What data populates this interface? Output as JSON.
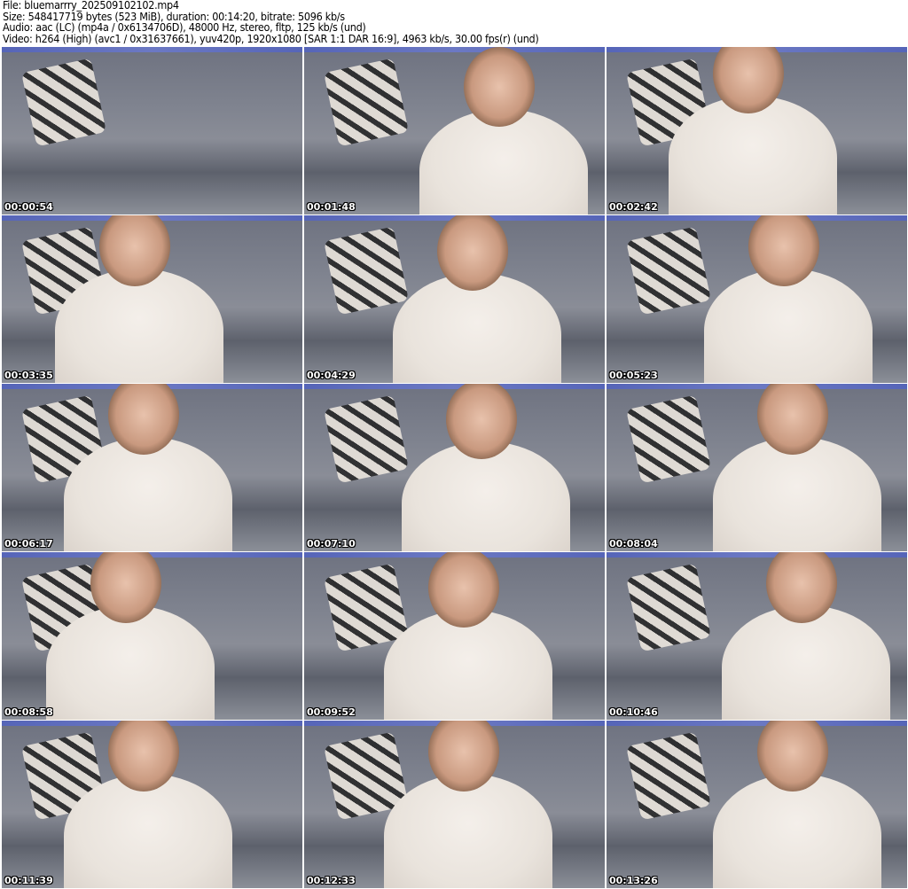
{
  "header": {
    "file": "File: bluemarrry_202509102102.mp4",
    "size": "Size: 548417719 bytes (523 MiB), duration: 00:14:20, bitrate: 5096 kb/s",
    "audio": "Audio: aac (LC) (mp4a / 0x6134706D), 48000 Hz, stereo, fltp, 125 kb/s (und)",
    "video": "Video: h264 (High) (avc1 / 0x31637661), yuv420p, 1920x1080 [SAR 1:1 DAR 16:9], 4963 kb/s, 30.00 fps(r) (und)"
  },
  "thumbnails": [
    {
      "timestamp": "00:00:54"
    },
    {
      "timestamp": "00:01:48"
    },
    {
      "timestamp": "00:02:42"
    },
    {
      "timestamp": "00:03:35"
    },
    {
      "timestamp": "00:04:29"
    },
    {
      "timestamp": "00:05:23"
    },
    {
      "timestamp": "00:06:17"
    },
    {
      "timestamp": "00:07:10"
    },
    {
      "timestamp": "00:08:04"
    },
    {
      "timestamp": "00:08:58"
    },
    {
      "timestamp": "00:09:52"
    },
    {
      "timestamp": "00:10:46"
    },
    {
      "timestamp": "00:11:39"
    },
    {
      "timestamp": "00:12:33"
    },
    {
      "timestamp": "00:13:26"
    }
  ]
}
